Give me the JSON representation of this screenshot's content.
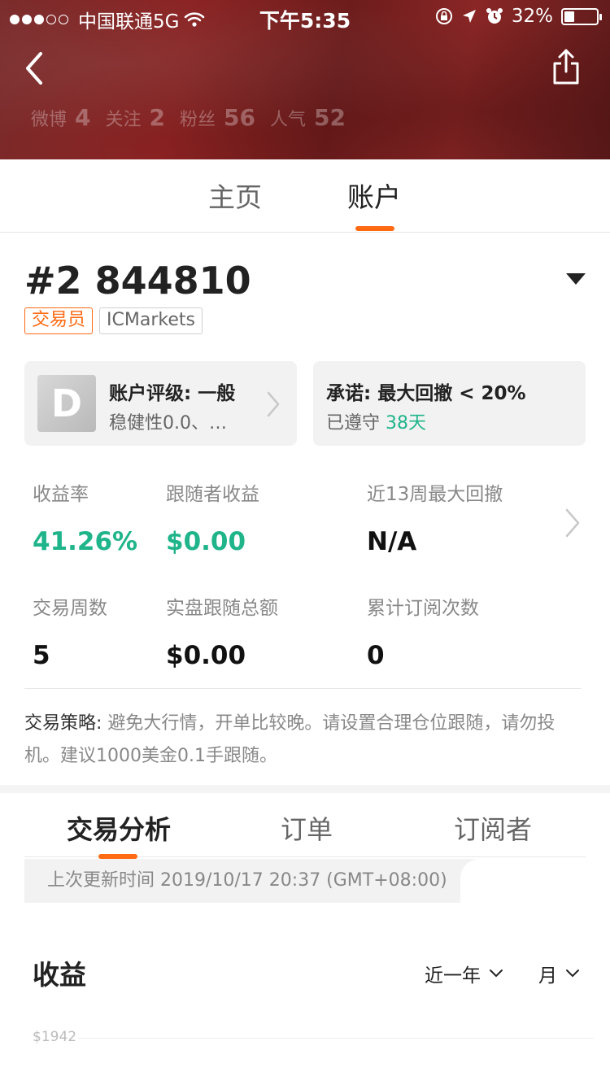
{
  "status_bar": {
    "carrier": "中国联通5G",
    "time": "下午5:35",
    "battery": "32%",
    "battery_level": 0.32
  },
  "profile_stats": [
    {
      "label": "微博",
      "value": "4"
    },
    {
      "label": "关注",
      "value": "2"
    },
    {
      "label": "粉丝",
      "value": "56"
    },
    {
      "label": "人气",
      "value": "52"
    }
  ],
  "main_tabs": [
    {
      "label": "主页",
      "active": false
    },
    {
      "label": "账户",
      "active": true
    }
  ],
  "account": {
    "id": "#2 844810",
    "badges": {
      "trader": "交易员",
      "broker": "ICMarkets"
    }
  },
  "rating_card": {
    "grade": "D",
    "title": "账户评级: 一般",
    "subtitle": "稳健性0.0、…"
  },
  "promise_card": {
    "title": "承诺: 最大回撤 < 20%",
    "kept_label": "已遵守",
    "kept_days": "38天"
  },
  "metrics": [
    {
      "label": "收益率",
      "value": "41.26%"
    },
    {
      "label": "跟随者收益",
      "value": "$0.00"
    },
    {
      "label": "近13周最大回撤",
      "value": "N/A"
    },
    {
      "label": "交易周数",
      "value": "5"
    },
    {
      "label": "实盘跟随总额",
      "value": "$0.00"
    },
    {
      "label": "累计订阅次数",
      "value": "0"
    }
  ],
  "strategy": {
    "label": "交易策略:",
    "text": "避免大行情，开单比较晚。请设置合理仓位跟随，请勿投机。建议1000美金0.1手跟随。"
  },
  "sub_tabs": [
    {
      "label": "交易分析",
      "active": true
    },
    {
      "label": "订单",
      "active": false
    },
    {
      "label": "订阅者",
      "active": false
    }
  ],
  "update_time": "上次更新时间 2019/10/17 20:37 (GMT+08:00)",
  "earnings": {
    "title": "收益",
    "period_filter": "近一年",
    "granularity_filter": "月",
    "y_tick": "$1942"
  },
  "colors": {
    "accent": "#ff6a13",
    "positive": "#1fb48a",
    "header_bg": "#7a2222"
  }
}
